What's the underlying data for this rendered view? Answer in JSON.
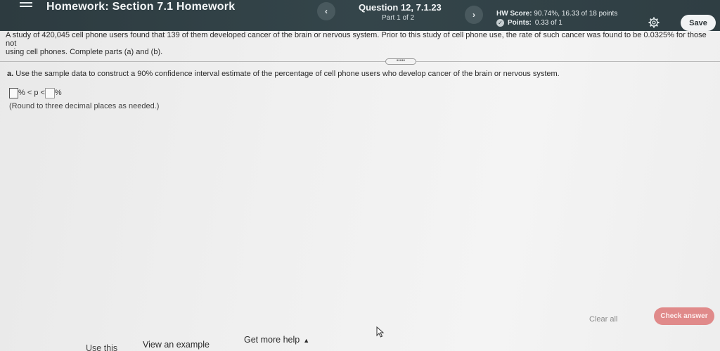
{
  "header": {
    "title": "Homework: Section 7.1 Homework",
    "prev_label": "‹",
    "next_label": "›",
    "question_title": "Question 12, 7.1.23",
    "question_part": "Part 1 of 2",
    "hw_score_label": "HW Score:",
    "hw_score_value": "90.74%, 16.33 of 18 points",
    "points_label": "Points:",
    "points_value": "0.33 of 1",
    "save_label": "Save"
  },
  "problem": {
    "intro_main": "A study of 420,045 cell phone users found that 139 of them developed cancer of the brain or nervous system. Prior to this study of cell phone use, the rate of such cancer was found to be 0.0325% for those not",
    "intro_line2": "using cell phones. Complete parts (a) and (b).",
    "expand_label": "•••••",
    "part_a_letter": "a.",
    "part_a_text": "Use the sample data to construct a 90% confidence interval estimate of the percentage of cell phone users who develop cancer of the brain or nervous system.",
    "ci_middle": "% < p <",
    "ci_end": "%",
    "round_note": "(Round to three decimal places as needed.)"
  },
  "footer": {
    "partial_link": "Use this",
    "view_example": "View an example",
    "get_help": "Get more help",
    "help_caret": "▲",
    "clear_all": "Clear all",
    "check_answer": "Check answer"
  },
  "colors": {
    "header_bg": "#2f3e43",
    "check_answer_bg": "#e08a8a",
    "save_bg": "#f1f3f4"
  },
  "icons": [
    "menu-icon",
    "chevron-left-icon",
    "chevron-right-icon",
    "points-status-icon",
    "settings-gear-icon",
    "mouse-cursor-icon"
  ]
}
